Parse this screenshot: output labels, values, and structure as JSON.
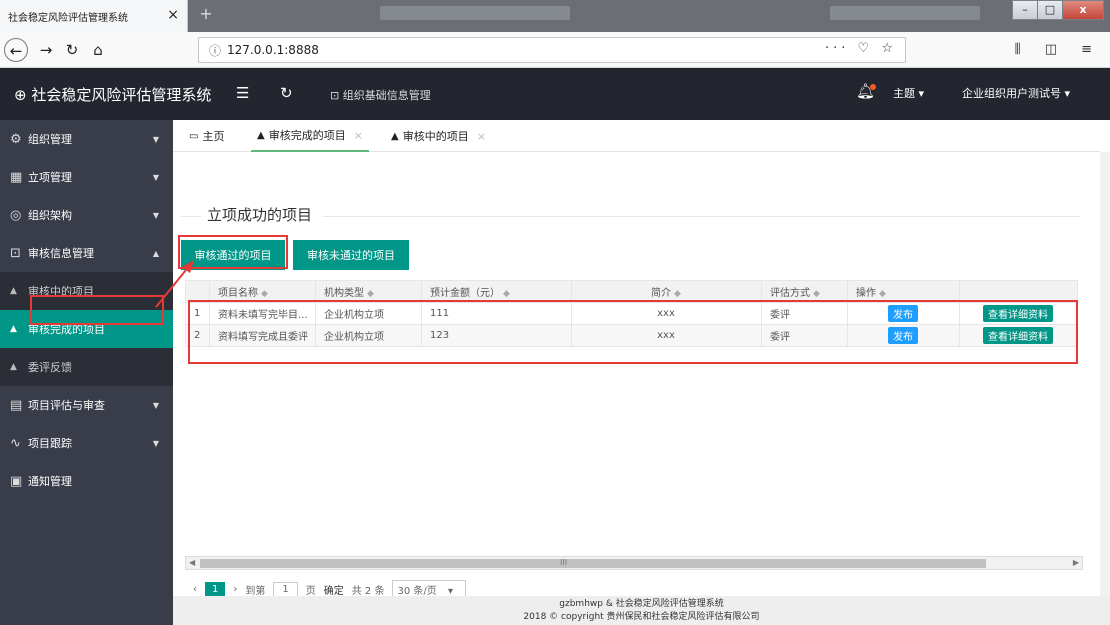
{
  "browser": {
    "tab_title": "社会稳定风险评估管理系统",
    "tab_close": "×",
    "new_tab": "+",
    "url_info": "ⓘ",
    "url": "127.0.0.1:8888",
    "url_actions": "··· ♡ ☆",
    "nav_right": "⫼ ◫ ≡",
    "window_buttons": [
      "–",
      "□",
      "x"
    ]
  },
  "header": {
    "app_title": "⊕ 社会稳定风险评估管理系统",
    "menu_icon": "☰",
    "refresh_icon": "↻",
    "crumb": "⊡ 组织基础信息管理",
    "theme_label": "主题 ▾",
    "user_label": "企业组织用户测试号 ▾"
  },
  "sidebar": {
    "items": [
      {
        "icon": "⚙",
        "label": "组织管理",
        "caret": "▼"
      },
      {
        "icon": "▦",
        "label": "立项管理",
        "caret": "▼"
      },
      {
        "icon": "◎",
        "label": "组织架构",
        "caret": "▼"
      },
      {
        "icon": "⊡",
        "label": "审核信息管理",
        "caret": "▲"
      }
    ],
    "sub_items": [
      {
        "icon": "▲",
        "label": "审核中的项目"
      },
      {
        "icon": "▲",
        "label": "审核完成的项目"
      },
      {
        "icon": "▲",
        "label": "委评反馈"
      }
    ],
    "items_after": [
      {
        "icon": "▤",
        "label": "项目评估与审查",
        "caret": "▼"
      },
      {
        "icon": "∿",
        "label": "项目跟踪",
        "caret": "▼"
      },
      {
        "icon": "▣",
        "label": "通知管理",
        "caret": ""
      }
    ]
  },
  "tabs": [
    {
      "label": "主页",
      "close": ""
    },
    {
      "label": "审核完成的项目",
      "close": "×"
    },
    {
      "label": "审核中的项目",
      "close": "×"
    }
  ],
  "content": {
    "legend": "立项成功的项目",
    "btn_passed": "审核通过的项目",
    "btn_failed": "审核未通过的项目"
  },
  "table": {
    "headers": [
      "项目名称",
      "机构类型",
      "预计金额（元）",
      "简介",
      "评估方式",
      "操作"
    ],
    "sort_icon": "◆",
    "rows": [
      {
        "idx": "1",
        "name": "资料未填写完毕目...",
        "type": "企业机构立项",
        "amount": "111",
        "intro": "xxx",
        "method": "委评",
        "action1": "发布",
        "action2": "查看详细资料"
      },
      {
        "idx": "2",
        "name": "资料填写完成且委评",
        "type": "企业机构立项",
        "amount": "123",
        "intro": "xxx",
        "method": "委评",
        "action1": "发布",
        "action2": "查看详细资料"
      }
    ]
  },
  "scroll": {
    "mid": "III"
  },
  "pager": {
    "prev": "‹",
    "current": "1",
    "next": "›",
    "goto_label": "到第",
    "goto_value": "1",
    "page_unit": "页",
    "confirm": "确定",
    "total": "共 2 条",
    "per_page": "30 条/页",
    "dropdown": "▾"
  },
  "footer": {
    "line1": "gzbmhwp & 社会稳定风险评估管理系统",
    "line2": "2018 © copyright 贵州保民和社会稳定风险评估有限公司"
  }
}
